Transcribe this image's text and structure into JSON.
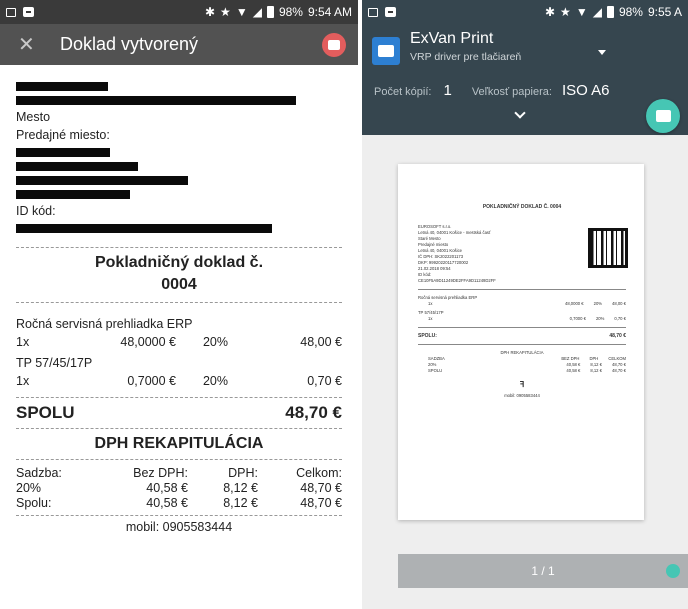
{
  "left": {
    "status": {
      "battery": "98%",
      "time": "9:54 AM"
    },
    "appbar": {
      "title": "Doklad vytvorený"
    },
    "receipt": {
      "mesto": "Mesto",
      "predajne": "Predajné miesto:",
      "id_kod": "ID kód:",
      "doc_title": "Pokladničný doklad č.",
      "doc_number": "0004",
      "items": [
        {
          "name": "Ročná servisná prehliadka ERP",
          "qty": "1x",
          "price": "48,0000 €",
          "vat": "20%",
          "total": "48,00 €"
        },
        {
          "name": "TP 57/45/17P",
          "qty": "1x",
          "price": "0,7000 €",
          "vat": "20%",
          "total": "0,70 €"
        }
      ],
      "total_label": "SPOLU",
      "total_value": "48,70 €",
      "recap_title": "DPH REKAPITULÁCIA",
      "recap_header": {
        "c1": "Sadzba:",
        "c2": "Bez DPH:",
        "c3": "DPH:",
        "c4": "Celkom:"
      },
      "recap_rows": [
        {
          "c1": "20%",
          "c2": "40,58 €",
          "c3": "8,12 €",
          "c4": "48,70 €"
        },
        {
          "c1": "Spolu:",
          "c2": "40,58 €",
          "c3": "8,12 €",
          "c4": "48,70 €"
        }
      ],
      "mobile": "mobil: 0905583444"
    }
  },
  "right": {
    "status": {
      "battery": "98%",
      "time": "9:55 A"
    },
    "printer": {
      "name": "ExVan Print",
      "description": "VRP driver pre tlačiareň"
    },
    "options": {
      "copies_label": "Počet kópií:",
      "copies_value": "1",
      "paper_label": "Veľkosť papiera:",
      "paper_value": "ISO A6"
    },
    "preview": {
      "title": "POKLADNIČNÝ DOKLAD Č. 0004",
      "seller_lines": [
        "EUROSOFT s.r.o.",
        "Letná 40, 04001 Košice - mestská časť",
        "Staré Mesto",
        "Predajné miesto",
        "Letná 40, 04001 Košice",
        "IČ DPH: SK2022201173",
        "DKP: 99920220117720002",
        "21.02.2018 09:54",
        "ID kód:",
        "CE10F5A9D11249DE2FFA9D11249D2FF"
      ],
      "items": [
        {
          "name": "Ročná servisná prehliadka ERP",
          "qty": "1x",
          "price": "48,0000 €",
          "vat": "20%",
          "total": "48,00 €"
        },
        {
          "name": "TP 57/45/17P",
          "qty": "1x",
          "price": "0,7000 €",
          "vat": "20%",
          "total": "0,70 €"
        }
      ],
      "total_label": "SPOLU:",
      "total_value": "48,70 €",
      "recap_title": "DPH REKAPITULÁCIA",
      "recap_header": [
        "SADZBA",
        "BEZ DPH",
        "DPH",
        "CELKOM"
      ],
      "recap_rows": [
        [
          "20%",
          "40,58 €",
          "8,12 €",
          "48,70 €"
        ],
        [
          "SPOLU",
          "40,58 €",
          "8,12 €",
          "48,70 €"
        ]
      ],
      "logo": "ꟻ",
      "mobile": "mobil: 0905583444"
    },
    "pagebar": {
      "label": "1 / 1"
    }
  }
}
